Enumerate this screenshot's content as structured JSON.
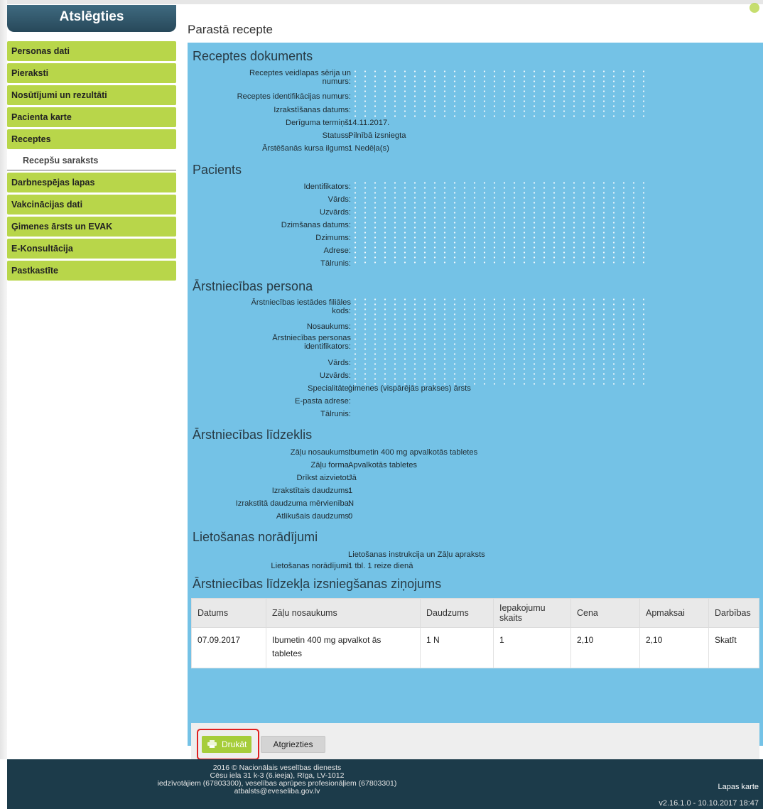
{
  "sidebar": {
    "header": "Atslēgties",
    "items": [
      "Personas dati",
      "Pieraksti",
      "Nosūtījumi un rezultāti",
      "Pacienta karte",
      "Receptes"
    ],
    "sub_item": "Recepšu saraksts",
    "items_after": [
      "Darbnespējas lapas",
      "Vakcinācijas dati",
      "Ģimenes ārsts un EVAK",
      "E-Konsultācija",
      "Pastkastīte"
    ]
  },
  "page_title": "Parastā recepte",
  "sections": {
    "doc": "Receptes dokuments",
    "patient": "Pacients",
    "doctor": "Ārstniecības persona",
    "medicine": "Ārstniecības līdzeklis",
    "usage": "Lietošanas norādījumi",
    "dispense": "Ārstniecības līdzekļa izsniegšanas ziņojums"
  },
  "doc": {
    "series_l1": "Receptes veidlapas sērija un",
    "series_l2": "numurs:",
    "id": "Receptes identifikācijas numurs:",
    "date": "Izrakstīšanas datums:",
    "valid": "Derīguma termiņš:",
    "valid_v": "14.11.2017.",
    "status": "Statuss:",
    "status_v": "Pilnībā izsniegta",
    "course": "Ārstēšanās kursa ilgums:",
    "course_v": "1 Nedēļa(s)"
  },
  "patient": {
    "ident": "Identifikators:",
    "name": "Vārds:",
    "surname": "Uzvārds:",
    "birth": "Dzimšanas datums:",
    "gender": "Dzimums:",
    "address": "Adrese:",
    "phone": "Tālrunis:"
  },
  "doctor": {
    "branch_l1": "Ārstniecības iestādes filiāles",
    "branch_l2": "kods:",
    "title": "Nosaukums:",
    "pid_l1": "Ārstniecības personas",
    "pid_l2": "identifikators:",
    "name": "Vārds:",
    "surname": "Uzvārds:",
    "spec": "Specialitāte:",
    "spec_v": "ģimenes (vispārējās prakses) ārsts",
    "email": "E-pasta adrese:",
    "phone": "Tālrunis:"
  },
  "medicine": {
    "name": "Zāļu nosaukums:",
    "name_v": "Ibumetin 400 mg apvalkotās tabletes",
    "form": "Zāļu forma:",
    "form_v": "Apvalkotās tabletes",
    "subst": "Drīkst aizvietot:",
    "subst_v": "Jā",
    "qty": "Izrakstītais daudzums:",
    "qty_v": "1",
    "unit": "Izrakstītā daudzuma mērvienība:",
    "unit_v": "N",
    "left": "Atlikušais daudzums:",
    "left_v": "0"
  },
  "usage": {
    "link": "Lietošanas instrukcija un Zāļu apraksts",
    "label": "Lietošanas norādījumi:",
    "value": "1 tbl. 1 reize dienā"
  },
  "table": {
    "headers": [
      "Datums",
      "Zāļu nosaukums",
      "Daudzums",
      "Iepakojumu skaits",
      "Cena",
      "Apmaksai",
      "Darbības"
    ],
    "row": {
      "date": "07.09.2017",
      "name": "Ibumetin 400 mg apvalkot ās tabletes",
      "qty": "1 N",
      "packs": "1",
      "price": "2,10",
      "pay": "2,10",
      "action": "Skatīt"
    }
  },
  "buttons": {
    "print": "Drukāt",
    "back": "Atgriezties"
  },
  "footer": {
    "line1": "2016 © Nacionālais veselības dienests",
    "line2": "Cēsu iela 31 k-3 (6.ieeja), Rīga, LV-1012",
    "line3": "iedzīvotājiem (67803300), veselības aprūpes profesionāļiem (67803301)",
    "line4": "atbalsts@eveseliba.gov.lv",
    "sitemap": "Lapas karte",
    "version": "v2.16.1.0 - 10.10.2017 18:47"
  },
  "colors": {
    "accent": "#b8d64a",
    "content_bg": "#74c2e6",
    "header_bg": "#27485a",
    "footer_bg": "#1c3b4a",
    "highlight": "#e02020"
  }
}
